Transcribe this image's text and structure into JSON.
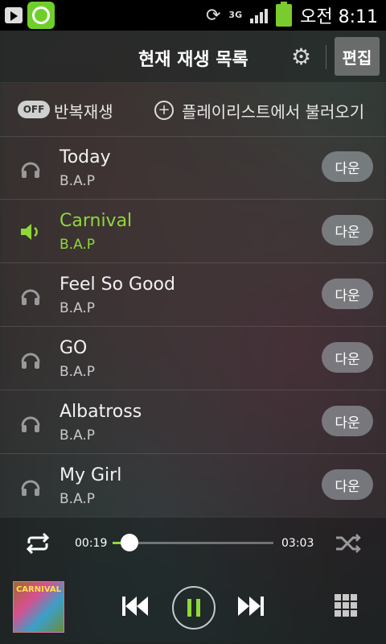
{
  "status_bar": {
    "carrier_label": "3G",
    "ampm": "오전",
    "time": "8:11"
  },
  "header": {
    "title": "현재 재생 목록",
    "edit_label": "편집"
  },
  "options": {
    "repeat_toggle": "OFF",
    "repeat_label": "반복재생",
    "load_playlist_label": "플레이리스트에서 불러오기"
  },
  "playlist": [
    {
      "title": "Today",
      "artist": "B.A.P",
      "action": "다운",
      "playing": false
    },
    {
      "title": "Carnival",
      "artist": "B.A.P",
      "action": "다운",
      "playing": true
    },
    {
      "title": "Feel So Good",
      "artist": "B.A.P",
      "action": "다운",
      "playing": false
    },
    {
      "title": "GO",
      "artist": "B.A.P",
      "action": "다운",
      "playing": false
    },
    {
      "title": "Albatross",
      "artist": "B.A.P",
      "action": "다운",
      "playing": false
    },
    {
      "title": "My Girl",
      "artist": "B.A.P",
      "action": "다운",
      "playing": false
    }
  ],
  "player": {
    "current_time": "00:19",
    "total_time": "03:03",
    "progress": 0.104,
    "album_art_text": "CARNIVAL",
    "accent_color": "#8fd83a"
  }
}
